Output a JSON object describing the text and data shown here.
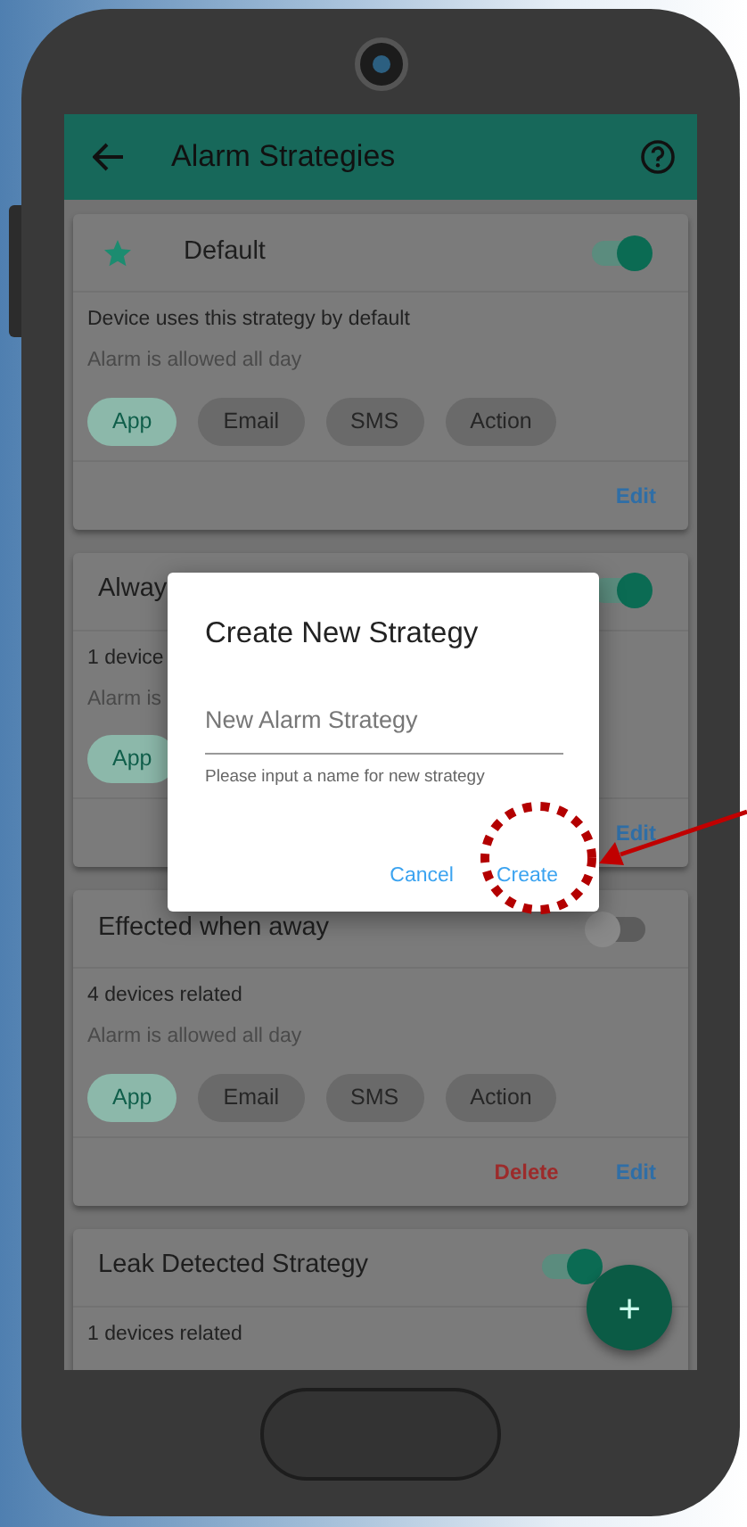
{
  "app_bar": {
    "title": "Alarm Strategies"
  },
  "strategies": [
    {
      "title": "Default",
      "starred": true,
      "enabled": true,
      "lines": [
        "Device uses this strategy by default",
        "Alarm is allowed all day"
      ],
      "channels": [
        {
          "label": "App",
          "selected": true
        },
        {
          "label": "Email",
          "selected": false
        },
        {
          "label": "SMS",
          "selected": false
        },
        {
          "label": "Action",
          "selected": false
        }
      ],
      "actions": [
        {
          "label": "Edit",
          "kind": "edit"
        }
      ]
    },
    {
      "title": "Alway",
      "starred": false,
      "enabled": true,
      "lines": [
        "1 device",
        "Alarm is"
      ],
      "channels": [
        {
          "label": "App",
          "selected": true
        }
      ],
      "actions": [
        {
          "label": "Edit",
          "kind": "edit"
        }
      ]
    },
    {
      "title": "Effected when away",
      "starred": false,
      "enabled": false,
      "lines": [
        "4 devices related",
        "Alarm is allowed all day"
      ],
      "channels": [
        {
          "label": "App",
          "selected": true
        },
        {
          "label": "Email",
          "selected": false
        },
        {
          "label": "SMS",
          "selected": false
        },
        {
          "label": "Action",
          "selected": false
        }
      ],
      "actions": [
        {
          "label": "Delete",
          "kind": "delete"
        },
        {
          "label": "Edit",
          "kind": "edit"
        }
      ]
    },
    {
      "title": "Leak Detected Strategy",
      "starred": false,
      "enabled": true,
      "lines": [
        "1 devices related"
      ]
    }
  ],
  "dialog": {
    "title": "Create New Strategy",
    "placeholder": "New Alarm Strategy",
    "helper": "Please input a name for new strategy",
    "buttons": [
      {
        "label": "Cancel"
      },
      {
        "label": "Create"
      }
    ]
  },
  "fab": {
    "label": "+"
  }
}
